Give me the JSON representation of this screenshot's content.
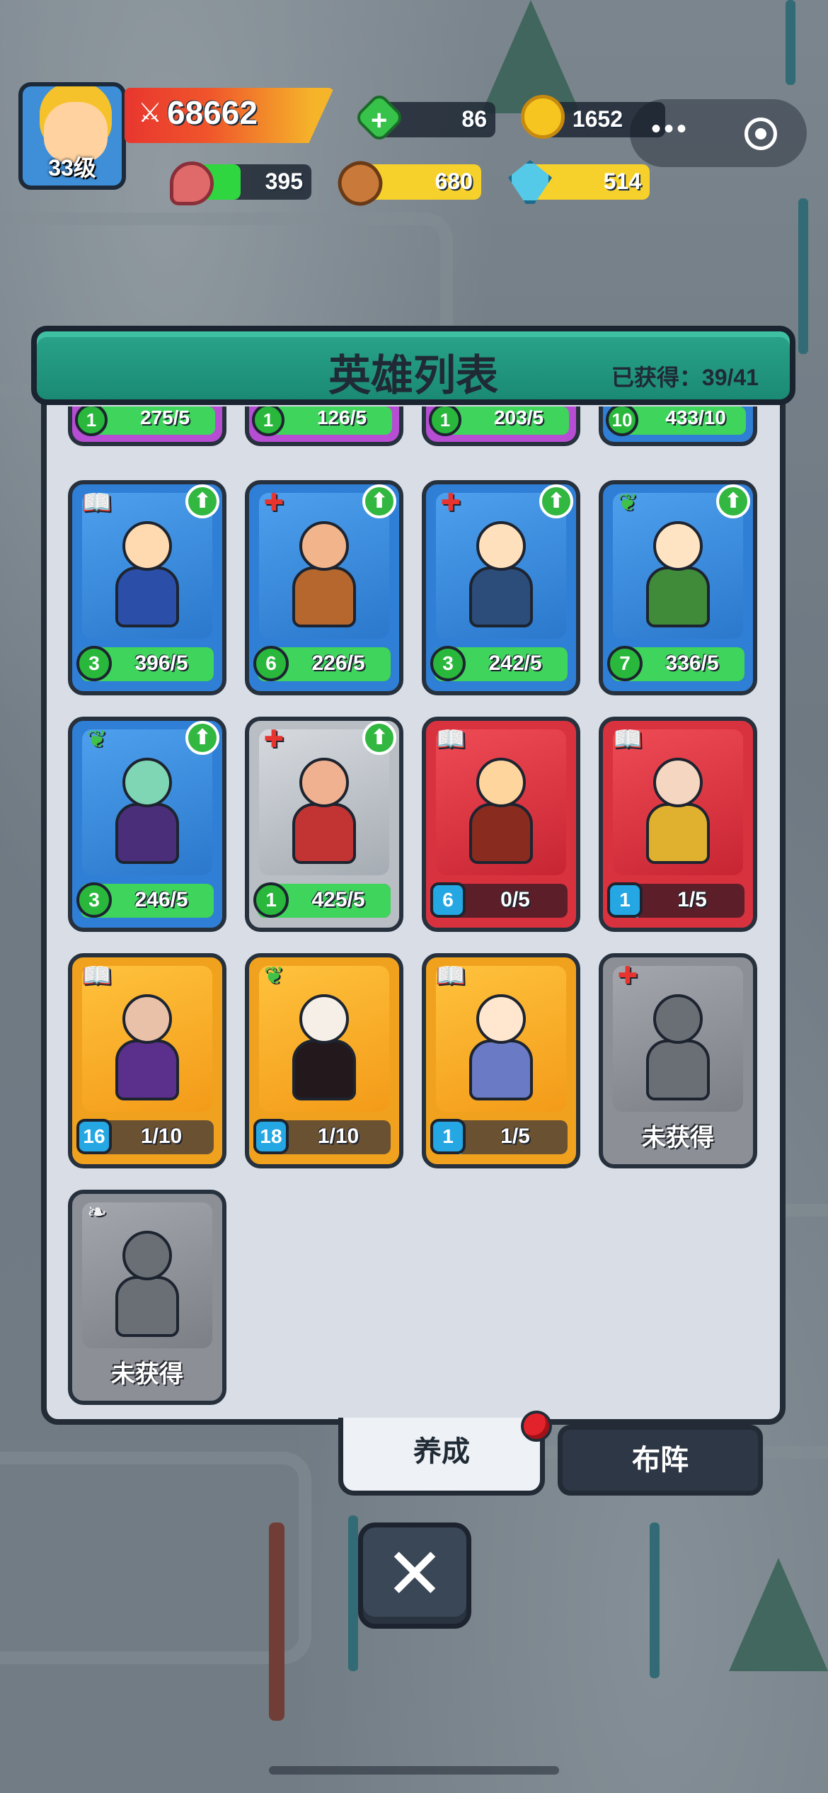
{
  "player": {
    "level": "33级",
    "power": "68662"
  },
  "resources": {
    "gems": "86",
    "gold": "1652",
    "meat": "395",
    "wood": "680",
    "crystal": "514"
  },
  "panel": {
    "title": "英雄列表",
    "obtained": "已获得：39/41"
  },
  "partial_row": [
    {
      "level": "1",
      "progress": "275/5",
      "color": "purple"
    },
    {
      "level": "1",
      "progress": "126/5",
      "color": "purple"
    },
    {
      "level": "1",
      "progress": "203/5",
      "color": "purple"
    },
    {
      "level": "10",
      "progress": "433/10",
      "color": "blue"
    }
  ],
  "heroes": [
    {
      "name": "priest",
      "rarity": "blue",
      "class_icon": "book",
      "level": "3",
      "progress": "396/5",
      "fill": 1.0,
      "upgradable": true,
      "obtained": true
    },
    {
      "name": "pirate",
      "rarity": "blue",
      "class_icon": "cross",
      "level": "6",
      "progress": "226/5",
      "fill": 1.0,
      "upgradable": true,
      "obtained": true
    },
    {
      "name": "axeman",
      "rarity": "blue",
      "class_icon": "cross",
      "level": "3",
      "progress": "242/5",
      "fill": 1.0,
      "upgradable": true,
      "obtained": true
    },
    {
      "name": "elf-archer",
      "rarity": "blue",
      "class_icon": "leaf",
      "level": "7",
      "progress": "336/5",
      "fill": 1.0,
      "upgradable": true,
      "obtained": true
    },
    {
      "name": "goblin",
      "rarity": "blue",
      "class_icon": "leaf",
      "level": "3",
      "progress": "246/5",
      "fill": 1.0,
      "upgradable": true,
      "obtained": true
    },
    {
      "name": "warrior",
      "rarity": "silver",
      "class_icon": "cross",
      "level": "1",
      "progress": "425/5",
      "fill": 1.0,
      "upgradable": true,
      "obtained": true
    },
    {
      "name": "shield-hero",
      "rarity": "red",
      "class_icon": "book",
      "level": "6",
      "progress": "0/5",
      "fill": 0.0,
      "upgradable": false,
      "obtained": true
    },
    {
      "name": "dragon-mage",
      "rarity": "red",
      "class_icon": "book",
      "level": "1",
      "progress": "1/5",
      "fill": 0.2,
      "upgradable": false,
      "obtained": true
    },
    {
      "name": "dancer",
      "rarity": "orange",
      "class_icon": "book",
      "level": "16",
      "progress": "1/10",
      "fill": 0.1,
      "upgradable": false,
      "obtained": true
    },
    {
      "name": "vampire",
      "rarity": "orange",
      "class_icon": "leaf",
      "level": "18",
      "progress": "1/10",
      "fill": 0.1,
      "upgradable": false,
      "obtained": true
    },
    {
      "name": "old-wizard",
      "rarity": "orange",
      "class_icon": "book",
      "level": "1",
      "progress": "1/5",
      "fill": 0.2,
      "upgradable": false,
      "obtained": true
    },
    {
      "name": "knight",
      "rarity": "gray",
      "class_icon": "cross",
      "locked_label": "未获得",
      "obtained": false
    },
    {
      "name": "dark-warrior",
      "rarity": "gray",
      "class_icon": "wing",
      "locked_label": "未获得",
      "obtained": false
    }
  ],
  "tabs": {
    "develop": "养成",
    "formation": "布阵"
  },
  "close_label": "✕",
  "colors": {
    "header": "#1b8a74",
    "blue_card": "#2f7fd6",
    "red_card": "#d9323f",
    "orange_card": "#f0a21e",
    "progress_green": "#3fd45c",
    "progress_cyan": "#29b8f0"
  }
}
